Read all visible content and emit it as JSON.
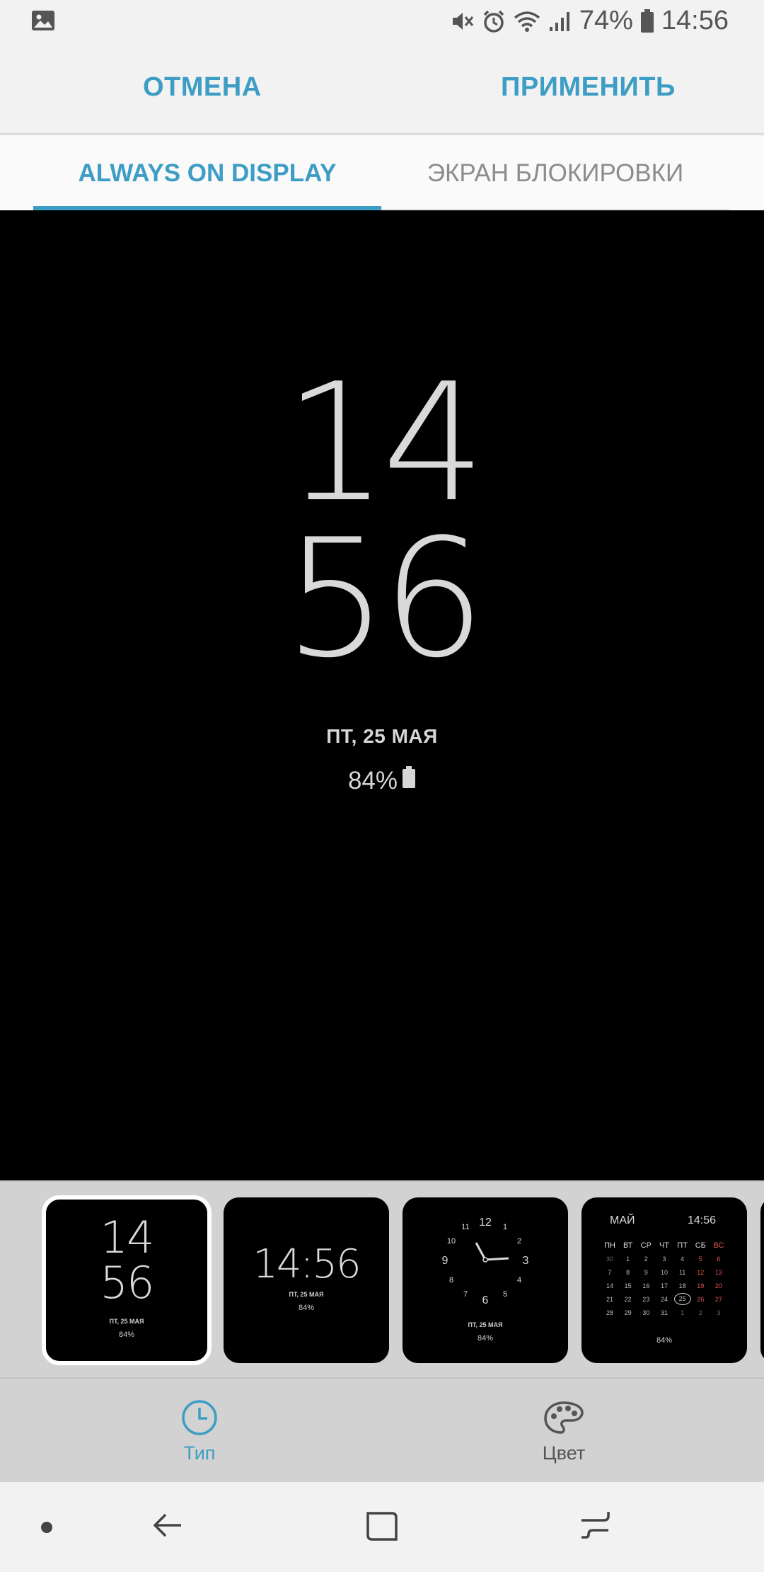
{
  "status_bar": {
    "battery_percent": "74%",
    "time": "14:56",
    "icons": [
      "image-icon",
      "mute-icon",
      "alarm-icon",
      "wifi-icon",
      "signal-icon",
      "battery-icon"
    ]
  },
  "action_bar": {
    "cancel_label": "ОТМЕНА",
    "apply_label": "ПРИМЕНИТЬ"
  },
  "tabs": [
    {
      "label": "ALWAYS ON DISPLAY",
      "selected": true
    },
    {
      "label": "ЭКРАН БЛОКИРОВКИ",
      "selected": false
    }
  ],
  "preview": {
    "hour": "14",
    "minute": "56",
    "date": "ПТ, 25 МАЯ",
    "battery": "84%"
  },
  "thumbnails": [
    {
      "style": "stacked-digital",
      "hour": "14",
      "minute": "56",
      "date": "ПТ, 25 МАЯ",
      "battery": "84%",
      "selected": true
    },
    {
      "style": "inline-digital",
      "time": "14:56",
      "date": "ПТ, 25 МАЯ",
      "battery": "84%"
    },
    {
      "style": "analog",
      "numbers": [
        "12",
        "1",
        "2",
        "3",
        "4",
        "5",
        "6",
        "7",
        "8",
        "9",
        "10",
        "11"
      ],
      "date": "ПТ, 25 МАЯ",
      "battery": "84%"
    },
    {
      "style": "calendar",
      "month": "МАЙ",
      "time": "14:56",
      "battery": "84%",
      "weekdays": [
        "ПН",
        "ВТ",
        "СР",
        "ЧТ",
        "ПТ",
        "СБ",
        "ВС"
      ],
      "weeks": [
        [
          "30",
          "1",
          "2",
          "3",
          "4",
          "5",
          "6"
        ],
        [
          "7",
          "8",
          "9",
          "10",
          "11",
          "12",
          "13"
        ],
        [
          "14",
          "15",
          "16",
          "17",
          "18",
          "19",
          "20"
        ],
        [
          "21",
          "22",
          "23",
          "24",
          "25",
          "26",
          "27"
        ],
        [
          "28",
          "29",
          "30",
          "31",
          "1",
          "2",
          "3"
        ]
      ],
      "today": "25"
    }
  ],
  "bottom_tabs": [
    {
      "label": "Тип",
      "icon": "clock-icon",
      "selected": true
    },
    {
      "label": "Цвет",
      "icon": "palette-icon",
      "selected": false
    }
  ],
  "nav_bar": {
    "items": [
      "dot-icon",
      "back-icon",
      "home-icon",
      "recents-icon"
    ]
  },
  "colors": {
    "accent": "#3d9dc4",
    "preview_background": "#000000",
    "weekend_red": "#e0564d"
  }
}
